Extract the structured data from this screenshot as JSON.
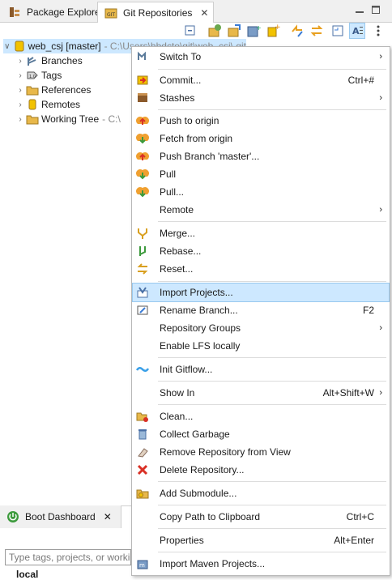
{
  "tabs": {
    "package_explorer": "Package Explorer",
    "git_repositories": "Git Repositories"
  },
  "tree": {
    "repo": {
      "name": "web_csj [master]",
      "path": "- C:\\Users\\hbdcto\\git\\web_csj\\.git"
    },
    "children": [
      {
        "label": "Branches",
        "icon": "branches-icon"
      },
      {
        "label": "Tags",
        "icon": "tags-icon"
      },
      {
        "label": "References",
        "icon": "folder-icon"
      },
      {
        "label": "Remotes",
        "icon": "remotes-icon"
      },
      {
        "label": "Working Tree",
        "path": "- C:\\",
        "icon": "folder-icon"
      }
    ]
  },
  "menu": {
    "items": [
      {
        "label": "Switch To",
        "shortcut": "",
        "submenu": true,
        "icon": "switch-icon"
      },
      {
        "label": "Commit...",
        "shortcut": "Ctrl+#",
        "submenu": false,
        "icon": "commit-icon"
      },
      {
        "label": "Stashes",
        "shortcut": "",
        "submenu": true,
        "icon": "stash-icon"
      },
      {
        "label": "Push to origin",
        "shortcut": "",
        "submenu": false,
        "icon": "push-icon"
      },
      {
        "label": "Fetch from origin",
        "shortcut": "",
        "submenu": false,
        "icon": "fetch-icon"
      },
      {
        "label": "Push Branch 'master'...",
        "shortcut": "",
        "submenu": false,
        "icon": "push-branch-icon"
      },
      {
        "label": "Pull",
        "shortcut": "",
        "submenu": false,
        "icon": "pull-icon"
      },
      {
        "label": "Pull...",
        "shortcut": "",
        "submenu": false,
        "icon": "pull-dialog-icon"
      },
      {
        "label": "Remote",
        "shortcut": "",
        "submenu": true,
        "icon": ""
      },
      {
        "label": "Merge...",
        "shortcut": "",
        "submenu": false,
        "icon": "merge-icon"
      },
      {
        "label": "Rebase...",
        "shortcut": "",
        "submenu": false,
        "icon": "rebase-icon"
      },
      {
        "label": "Reset...",
        "shortcut": "",
        "submenu": false,
        "icon": "reset-icon"
      },
      {
        "label": "Import Projects...",
        "shortcut": "",
        "submenu": false,
        "icon": "import-icon"
      },
      {
        "label": "Rename Branch...",
        "shortcut": "F2",
        "submenu": false,
        "icon": "rename-icon"
      },
      {
        "label": "Repository Groups",
        "shortcut": "",
        "submenu": true,
        "icon": ""
      },
      {
        "label": "Enable LFS locally",
        "shortcut": "",
        "submenu": false,
        "icon": ""
      },
      {
        "label": "Init Gitflow...",
        "shortcut": "",
        "submenu": false,
        "icon": "gitflow-icon"
      },
      {
        "label": "Show In",
        "shortcut": "Alt+Shift+W",
        "submenu": true,
        "icon": ""
      },
      {
        "label": "Clean...",
        "shortcut": "",
        "submenu": false,
        "icon": "clean-icon"
      },
      {
        "label": "Collect Garbage",
        "shortcut": "",
        "submenu": false,
        "icon": "garbage-icon"
      },
      {
        "label": "Remove Repository from View",
        "shortcut": "",
        "submenu": false,
        "icon": "remove-icon"
      },
      {
        "label": "Delete Repository...",
        "shortcut": "",
        "submenu": false,
        "icon": "delete-icon"
      },
      {
        "label": "Add Submodule...",
        "shortcut": "",
        "submenu": false,
        "icon": "submodule-icon"
      },
      {
        "label": "Copy Path to Clipboard",
        "shortcut": "Ctrl+C",
        "submenu": false,
        "icon": ""
      },
      {
        "label": "Properties",
        "shortcut": "Alt+Enter",
        "submenu": false,
        "icon": ""
      },
      {
        "label": "Import Maven Projects...",
        "shortcut": "",
        "submenu": false,
        "icon": "maven-import-icon"
      }
    ]
  },
  "bottom": {
    "tab_label": "Boot Dashboard",
    "filter_placeholder": "Type tags, projects, or working set names to match (incl. * and ? wildcards)",
    "local_label": "local"
  },
  "colors": {
    "highlight": "#cde8ff",
    "separator": "#dcdcdc",
    "folder": "#e8b84a",
    "repo": "#f2c200",
    "push": "#f0a030",
    "pull": "#6aa84f",
    "delete": "#d93025",
    "gitflow": "#3aa0e8"
  }
}
